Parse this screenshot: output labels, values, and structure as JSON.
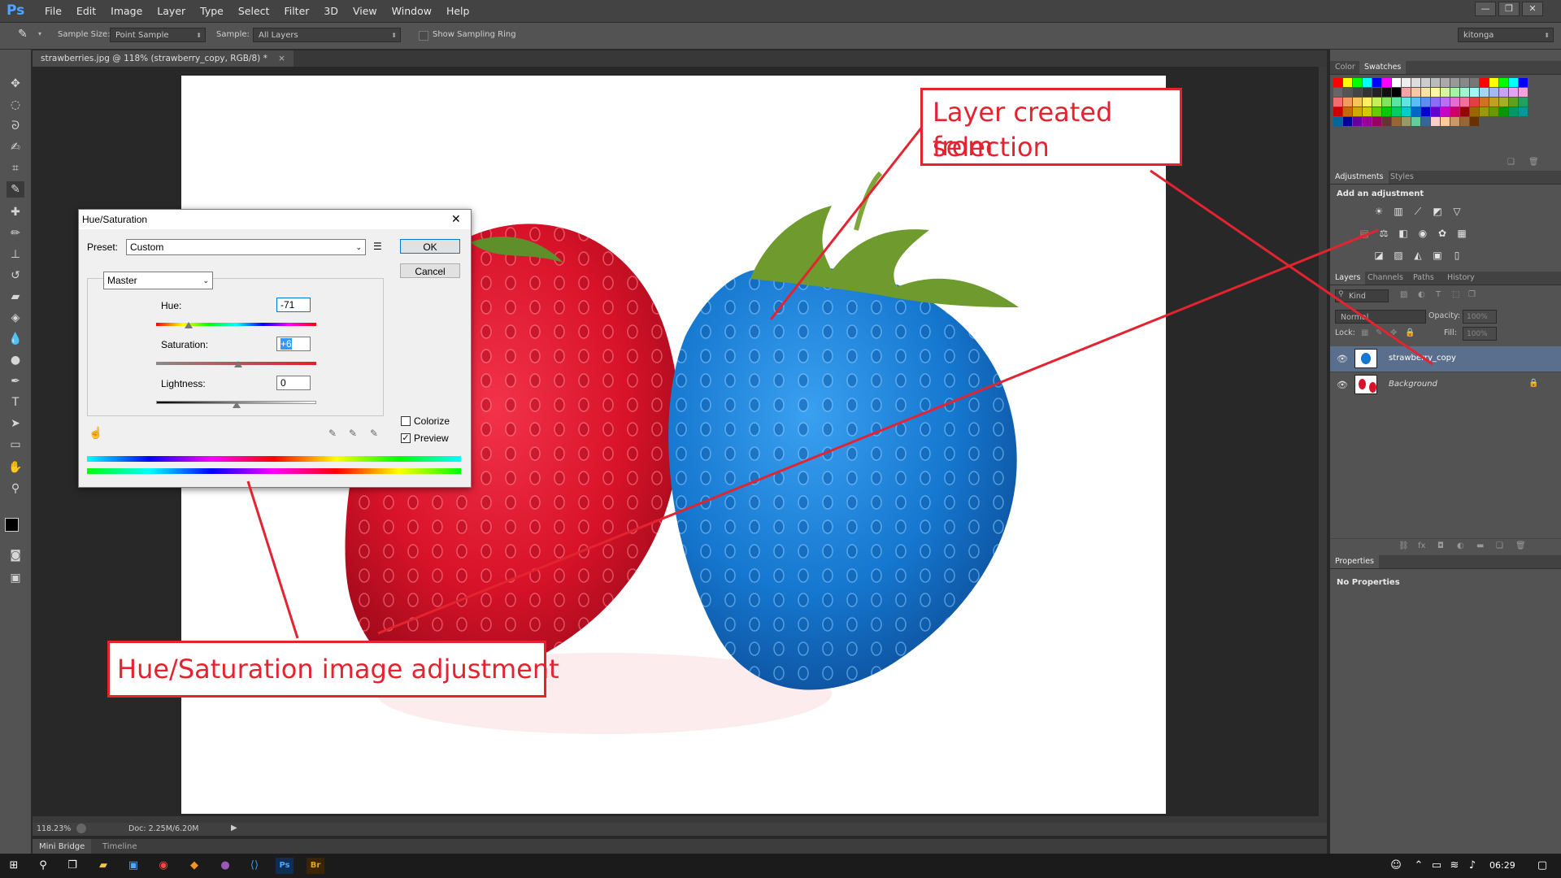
{
  "app": {
    "logo": "Ps"
  },
  "menu": [
    "File",
    "Edit",
    "Image",
    "Layer",
    "Type",
    "Select",
    "Filter",
    "3D",
    "View",
    "Window",
    "Help"
  ],
  "window_controls": {
    "minimize": "—",
    "restore": "❐",
    "close": "✕"
  },
  "options": {
    "sample_size_label": "Sample Size:",
    "sample_size_value": "Point Sample",
    "sample_label": "Sample:",
    "sample_value": "All Layers",
    "sampling_ring_label": "Show Sampling Ring",
    "workspace": "kitonga"
  },
  "document": {
    "tab_title": "strawberries.jpg @ 118% (strawberry_copy, RGB/8) *",
    "tab_close": "×"
  },
  "status": {
    "zoom": "118.23%",
    "doc_info": "Doc: 2.25M/6.20M"
  },
  "bottom_tabs": {
    "mini_bridge": "Mini Bridge",
    "timeline": "Timeline"
  },
  "panels": {
    "color_tab": "Color",
    "swatches_tab": "Swatches",
    "adjustments_tab": "Adjustments",
    "styles_tab": "Styles",
    "add_adjustment": "Add an adjustment",
    "layers_tab": "Layers",
    "channels_tab": "Channels",
    "paths_tab": "Paths",
    "history_tab": "History",
    "kind_label": "Kind",
    "blend_mode": "Normal",
    "opacity_label": "Opacity:",
    "opacity_value": "100%",
    "lock_label": "Lock:",
    "fill_label": "Fill:",
    "fill_value": "100%",
    "properties_tab": "Properties",
    "no_properties": "No Properties"
  },
  "layers": [
    {
      "name": "strawberry_copy",
      "selected": true
    },
    {
      "name": "Background",
      "selected": false,
      "locked": true
    }
  ],
  "hue_sat_dialog": {
    "title": "Hue/Saturation",
    "close": "✕",
    "preset_label": "Preset:",
    "preset_value": "Custom",
    "ok_label": "OK",
    "cancel_label": "Cancel",
    "channel": "Master",
    "hue_label": "Hue:",
    "hue_value": "-71",
    "saturation_label": "Saturation:",
    "saturation_value": "+6",
    "lightness_label": "Lightness:",
    "lightness_value": "0",
    "colorize_label": "Colorize",
    "colorize_checked": false,
    "preview_label": "Preview",
    "preview_checked": true
  },
  "annotations": {
    "layer_created_line1": "Layer created from",
    "layer_created_line2": "selection",
    "hue_sat_adjustment": "Hue/Saturation image adjustment",
    "color": "#e32430"
  },
  "taskbar": {
    "time": "06:29"
  },
  "colors": {
    "accent": "#4da6ff",
    "annotation": "#e32430",
    "selection": "#5a6f8e"
  }
}
